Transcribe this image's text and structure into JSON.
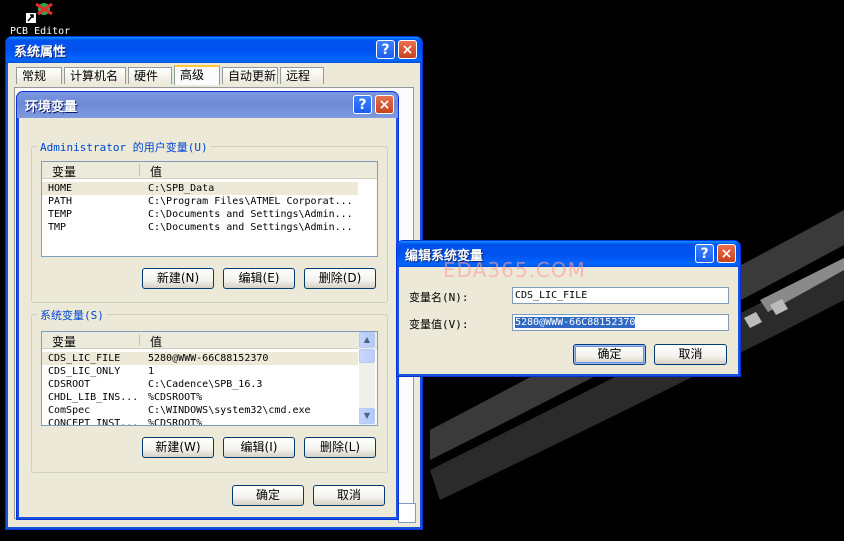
{
  "desktop": {
    "icon_label": "PCB Editor"
  },
  "sysprops": {
    "title": "系统属性",
    "tabs": [
      "常规",
      "计算机名",
      "硬件",
      "高级",
      "自动更新",
      "远程"
    ],
    "active_tab": "高级"
  },
  "envvars": {
    "title": "环境变量",
    "user_group_label": "Administrator 的用户变量(U)",
    "columns": [
      "变量",
      "值"
    ],
    "user_rows": [
      {
        "name": "HOME",
        "value": "C:\\SPB_Data"
      },
      {
        "name": "PATH",
        "value": "C:\\Program Files\\ATMEL Corporat..."
      },
      {
        "name": "TEMP",
        "value": "C:\\Documents and Settings\\Admin..."
      },
      {
        "name": "TMP",
        "value": "C:\\Documents and Settings\\Admin..."
      }
    ],
    "user_buttons": {
      "new": "新建(N)",
      "edit": "编辑(E)",
      "delete": "删除(D)"
    },
    "sys_group_label": "系统变量(S)",
    "sys_rows": [
      {
        "name": "CDS_LIC_FILE",
        "value": "5280@WWW-66C88152370"
      },
      {
        "name": "CDS_LIC_ONLY",
        "value": "1"
      },
      {
        "name": "CDSROOT",
        "value": "C:\\Cadence\\SPB_16.3"
      },
      {
        "name": "CHDL_LIB_INS...",
        "value": "%CDSROOT%"
      },
      {
        "name": "ComSpec",
        "value": "C:\\WINDOWS\\system32\\cmd.exe"
      },
      {
        "name": "CONCEPT_INST...",
        "value": "%CDSROOT%"
      }
    ],
    "sys_buttons": {
      "new": "新建(W)",
      "edit": "编辑(I)",
      "delete": "删除(L)"
    },
    "ok": "确定",
    "cancel": "取消"
  },
  "editdlg": {
    "title": "编辑系统变量",
    "name_label": "变量名(N):",
    "name_value": "CDS_LIC_FILE",
    "value_label": "变量值(V):",
    "value_value": "5280@WWW-66C88152370",
    "ok": "确定",
    "cancel": "取消"
  },
  "watermark": "EDA365.COM",
  "title_buttons": {
    "help": "?",
    "close": "×"
  },
  "scroll_glyphs": {
    "up": "▲",
    "down": "▼"
  },
  "colors": {
    "xp_blue": "#0053ee",
    "face": "#ece9d8",
    "selection": "#316ac5",
    "group_label": "#0046d5"
  }
}
